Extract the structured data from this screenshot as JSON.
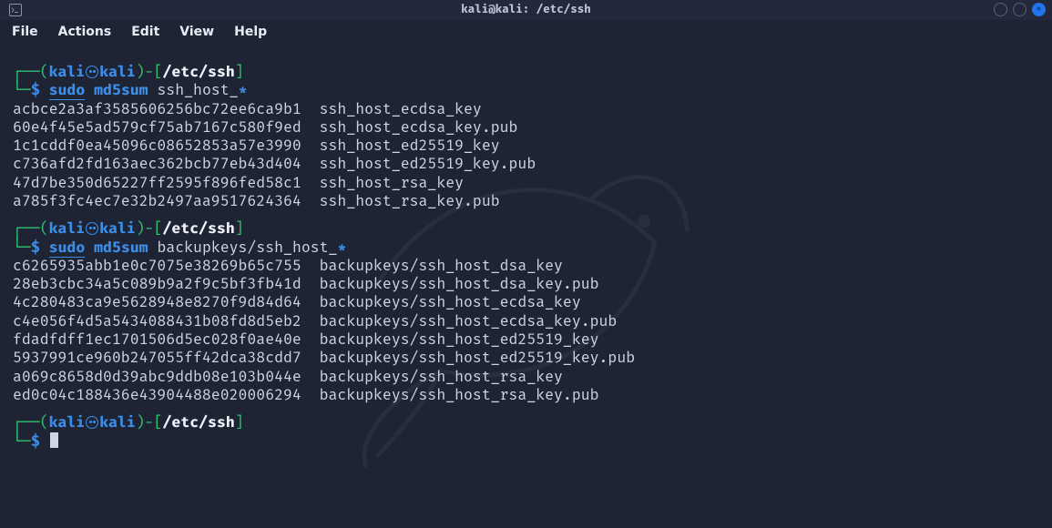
{
  "titlebar": {
    "title": "kali@kali: /etc/ssh"
  },
  "menubar": {
    "file": "File",
    "actions": "Actions",
    "edit": "Edit",
    "view": "View",
    "help": "Help"
  },
  "prompt": {
    "user": "kali",
    "host": "kali",
    "path": "/etc/ssh",
    "open": "┌──(",
    "close": ")-[",
    "end": "]",
    "cmd_prefix": "└─"
  },
  "blocks": [
    {
      "sudo": "sudo",
      "tool": "md5sum",
      "arg_plain": "ssh_host_",
      "arg_glob": "*",
      "rows": [
        {
          "h": "acbce2a3af3585606256bc72ee6ca9b1",
          "f": "ssh_host_ecdsa_key"
        },
        {
          "h": "60e4f45e5ad579cf75ab7167c580f9ed",
          "f": "ssh_host_ecdsa_key.pub"
        },
        {
          "h": "1c1cddf0ea45096c08652853a57e3990",
          "f": "ssh_host_ed25519_key"
        },
        {
          "h": "c736afd2fd163aec362bcb77eb43d404",
          "f": "ssh_host_ed25519_key.pub"
        },
        {
          "h": "47d7be350d65227ff2595f896fed58c1",
          "f": "ssh_host_rsa_key"
        },
        {
          "h": "a785f3fc4ec7e32b2497aa9517624364",
          "f": "ssh_host_rsa_key.pub"
        }
      ]
    },
    {
      "sudo": "sudo",
      "tool": "md5sum",
      "arg_plain": "backupkeys/ssh_host_",
      "arg_glob": "*",
      "rows": [
        {
          "h": "c6265935abb1e0c7075e38269b65c755",
          "f": "backupkeys/ssh_host_dsa_key"
        },
        {
          "h": "28eb3cbc34a5c089b9a2f9c5bf3fb41d",
          "f": "backupkeys/ssh_host_dsa_key.pub"
        },
        {
          "h": "4c280483ca9e5628948e8270f9d84d64",
          "f": "backupkeys/ssh_host_ecdsa_key"
        },
        {
          "h": "c4e056f4d5a5434088431b08fd8d5eb2",
          "f": "backupkeys/ssh_host_ecdsa_key.pub"
        },
        {
          "h": "fdadfdff1ec1701506d5ec028f0ae40e",
          "f": "backupkeys/ssh_host_ed25519_key"
        },
        {
          "h": "5937991ce960b247055ff42dca38cdd7",
          "f": "backupkeys/ssh_host_ed25519_key.pub"
        },
        {
          "h": "a069c8658d0d39abc9ddb08e103b044e",
          "f": "backupkeys/ssh_host_rsa_key"
        },
        {
          "h": "ed0c04c188436e43904488e020006294",
          "f": "backupkeys/ssh_host_rsa_key.pub"
        }
      ]
    }
  ],
  "symbols": {
    "dollar": "$"
  }
}
